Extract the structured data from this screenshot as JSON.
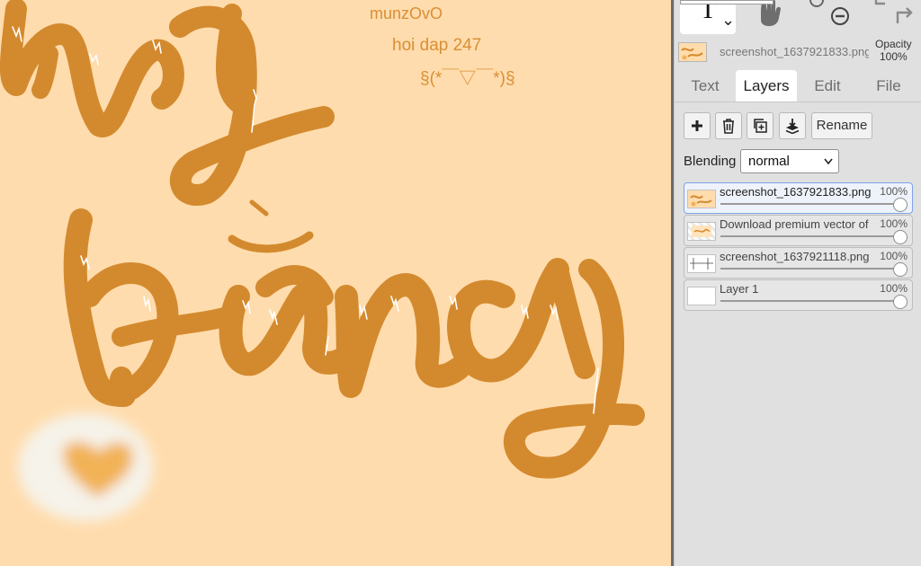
{
  "canvas": {
    "background": "#ffdcad",
    "ink_color": "#d38a2e",
    "text_layer_lines": [
      "munzOvO",
      "hoi dap 247",
      "§(*￣▽￣*)§"
    ]
  },
  "toolbar": {
    "text_tool_glyph": "T",
    "text_tool_caret": "⌄",
    "hand_tool_icon": "hand-icon",
    "zoom_out_icon": "zoom-out-icon",
    "redo_icon": "redo-icon"
  },
  "current_image": {
    "filename": "screenshot_1637921833.png",
    "opacity_label": "Opacity",
    "opacity_value": "100%"
  },
  "tabs": [
    {
      "label": "Text",
      "active": false
    },
    {
      "label": "Layers",
      "active": true
    },
    {
      "label": "Edit",
      "active": false
    },
    {
      "label": "File",
      "active": false
    }
  ],
  "layer_toolbar": {
    "add_icon": "plus-icon",
    "delete_icon": "trash-icon",
    "duplicate_icon": "duplicate-icon",
    "merge_icon": "merge-down-icon",
    "rename_label": "Rename"
  },
  "blending": {
    "label": "Blending",
    "value": "normal"
  },
  "layers": [
    {
      "name": "screenshot_1637921833.png",
      "opacity": "100%",
      "opacity_fraction": 1.0,
      "selected": true
    },
    {
      "name": "Download premium vector of",
      "opacity": "100%",
      "opacity_fraction": 1.0,
      "selected": false
    },
    {
      "name": "screenshot_1637921118.png",
      "opacity": "100%",
      "opacity_fraction": 1.0,
      "selected": false
    },
    {
      "name": "Layer 1",
      "opacity": "100%",
      "opacity_fraction": 1.0,
      "selected": false
    }
  ]
}
